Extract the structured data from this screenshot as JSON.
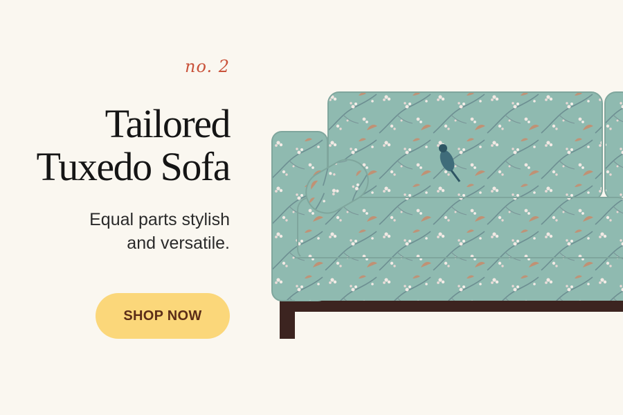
{
  "hero": {
    "eyebrow": "no. 2",
    "title_line1": "Tailored",
    "title_line2": "Tuxedo Sofa",
    "subtitle_line1": "Equal parts stylish",
    "subtitle_line2": "and versatile.",
    "cta_label": "SHOP NOW"
  },
  "product": {
    "image": "sofa-image",
    "fabric_pattern": "cherry-blossom-and-bird-print"
  },
  "colors": {
    "background": "#faf7f0",
    "accent": "#c9523a",
    "button": "#fbd77a",
    "button_text": "#5b2d18",
    "sofa_fabric": "#8fbab0",
    "sofa_base": "#3c2420"
  }
}
